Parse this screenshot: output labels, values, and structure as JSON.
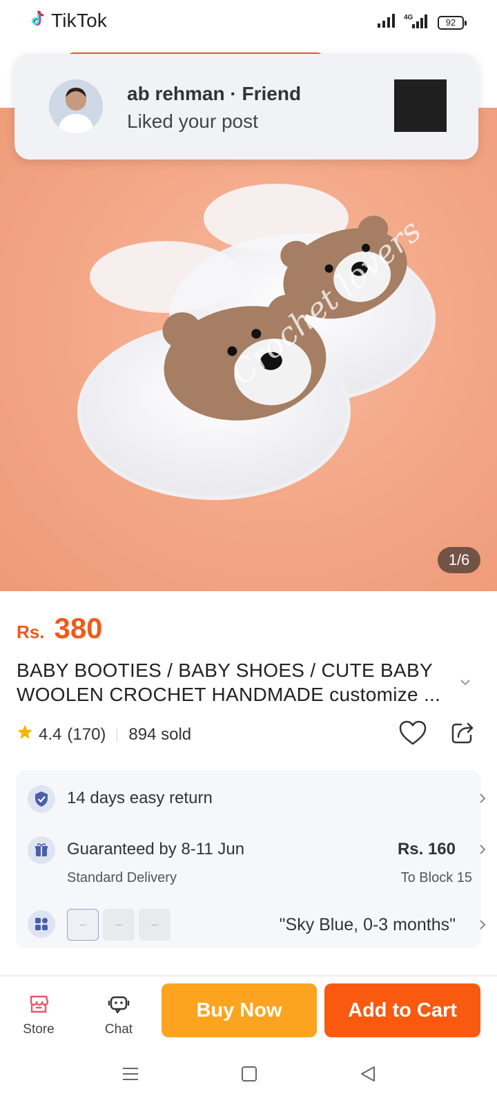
{
  "status_bar": {
    "app_label": "TikTok",
    "battery": "92",
    "network": "4G"
  },
  "notification": {
    "title": "ab rehman · Friend",
    "message": "Liked your post"
  },
  "product": {
    "image_counter": "1/6",
    "watermark": "Crochet lovers",
    "price_currency": "Rs.",
    "price_value": "380",
    "title_line1": "BABY BOOTIES / BABY SHOES / CUTE BABY",
    "title_line2": "WOOLEN CROCHET HANDMADE customize ...",
    "rating": "4.4",
    "rating_count": "(170)",
    "sold": "894 sold"
  },
  "info": {
    "return_label": "14 days easy return",
    "delivery_label": "Guaranteed by 8-11 Jun",
    "delivery_sub": "Standard Delivery",
    "delivery_price": "Rs. 160",
    "delivery_to": "To Block 15",
    "variant_selected": "\"Sky Blue, 0-3 months\""
  },
  "bottom_bar": {
    "store_label": "Store",
    "chat_label": "Chat",
    "buy_now_label": "Buy Now",
    "add_to_cart_label": "Add to Cart"
  },
  "colors": {
    "accent": "#f05a1a",
    "buy_now": "#fca41f",
    "add_to_cart": "#f95a0f",
    "star": "#f7b500"
  },
  "icons": {
    "app": "tiktok-icon",
    "signal": "signal-icon",
    "battery": "battery-icon",
    "heart": "heart-icon",
    "share": "share-icon",
    "return": "shield-check-icon",
    "delivery": "gift-icon",
    "variant": "grid-icon",
    "store": "store-icon",
    "chat": "chat-icon"
  }
}
